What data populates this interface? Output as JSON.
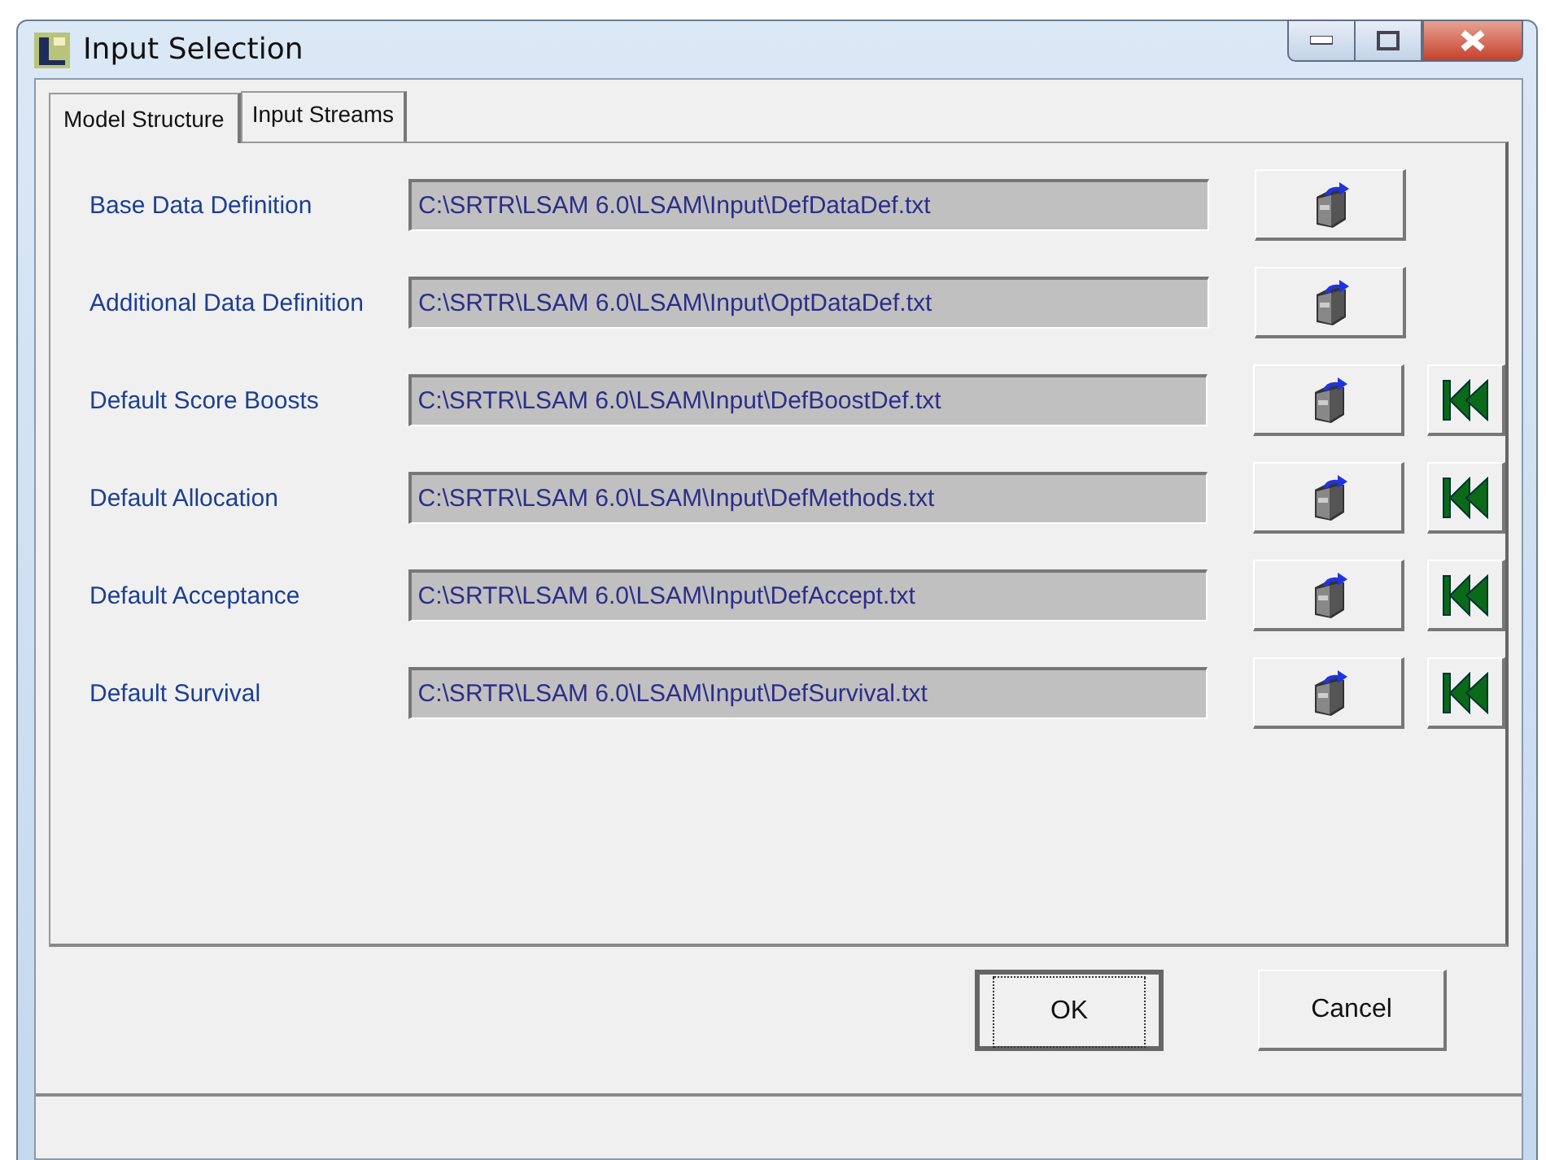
{
  "window": {
    "title": "Input Selection"
  },
  "tabs": [
    {
      "label": "Model Structure",
      "selected": true
    },
    {
      "label": "Input Streams",
      "selected": false
    }
  ],
  "rows": [
    {
      "label": "Base Data Definition",
      "path": "C:\\SRTR\\LSAM 6.0\\LSAM\\Input\\DefDataDef.txt",
      "reset_button": false
    },
    {
      "label": "Additional Data Definition",
      "path": "C:\\SRTR\\LSAM 6.0\\LSAM\\Input\\OptDataDef.txt",
      "reset_button": false
    },
    {
      "label": "Default Score Boosts",
      "path": "C:\\SRTR\\LSAM 6.0\\LSAM\\Input\\DefBoostDef.txt",
      "reset_button": true
    },
    {
      "label": "Default Allocation",
      "path": "C:\\SRTR\\LSAM 6.0\\LSAM\\Input\\DefMethods.txt",
      "reset_button": true
    },
    {
      "label": "Default Acceptance",
      "path": "C:\\SRTR\\LSAM 6.0\\LSAM\\Input\\DefAccept.txt",
      "reset_button": true
    },
    {
      "label": "Default Survival",
      "path": "C:\\SRTR\\LSAM 6.0\\LSAM\\Input\\DefSurvival.txt",
      "reset_button": true
    }
  ],
  "buttons": [
    {
      "label": "OK",
      "default": true
    },
    {
      "label": "Cancel",
      "default": false
    }
  ]
}
